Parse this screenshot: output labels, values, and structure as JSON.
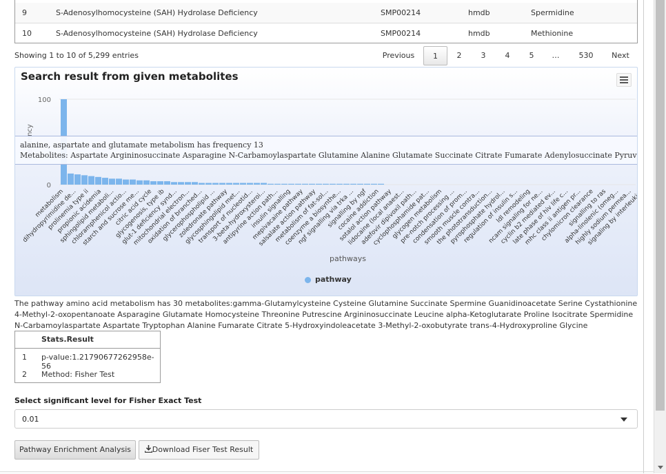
{
  "table": {
    "rows": [
      {
        "idx": "9",
        "name": "S-Adenosylhomocysteine (SAH) Hydrolase Deficiency",
        "smp": "SMP00214",
        "db": "hmdb",
        "metabolite": "Spermidine"
      },
      {
        "idx": "10",
        "name": "S-Adenosylhomocysteine (SAH) Hydrolase Deficiency",
        "smp": "SMP00214",
        "db": "hmdb",
        "metabolite": "Methionine"
      }
    ]
  },
  "pagination": {
    "info": "Showing 1 to 10 of 5,299 entries",
    "previous": "Previous",
    "pages": [
      "1",
      "2",
      "3",
      "4",
      "5",
      "…",
      "530"
    ],
    "next": "Next"
  },
  "chart_data": {
    "type": "bar",
    "title": "Search result from given metabolites",
    "ylabel": "Frequency",
    "xlabel": "pathways",
    "ylim": [
      0,
      100
    ],
    "yticks": [
      "100",
      "0"
    ],
    "categories": [
      "metabolism",
      "dihydropyrimidine de...",
      "prolinemia type ii",
      "propionic acidemia",
      "sphingolipid metaboli...",
      "chloramphenicol actio...",
      "starch and sucrose me...",
      "citric acid cycle",
      "glycogenosis, type ib",
      "glut-1 deficiency synd...",
      "mitochondrial electron...",
      "oxidation of branched...",
      "glycerophospholipid ...",
      "zoledronate pathway",
      "glycosphingolipid met...",
      "transport of nucleotid...",
      "3-beta-hydroxysteroi...",
      "antipyrine action path...",
      "insulin signalling",
      "mepivacaine pathway",
      "salsalate action pathway",
      "metabolism of fat-sol...",
      "coenzyme a biosynthe...",
      "ngf signalling via trka ...",
      "signalling by ngf",
      "cocaine addiction",
      "sotalol action pathway",
      "lidocaine (local anaest...",
      "adefovir dipivoxil path...",
      "cyclophosphamide pat...",
      "glycogen metabolism",
      "pre-notch processing ...",
      "condensation of prom...",
      "smooth muscle contra...",
      "the phototransduction...",
      "pyrophosphate hydrol...",
      "regulation of insulin s...",
      "ldl remodeling",
      "ncam signaling for ne...",
      "cyclin b2 mediated ev...",
      "late phase of hiv life c...",
      "mhc class ii antigen pr...",
      "chylomicron clearance",
      "signalling to ras",
      "alpha-linolenic (omeg...",
      "highly sodium permea...",
      "signaling by interleukins"
    ],
    "values": [
      100,
      13,
      12,
      11,
      10,
      9,
      8,
      7,
      7,
      6,
      6,
      5,
      5,
      4,
      4,
      4,
      3,
      3,
      3,
      3,
      2,
      2,
      2,
      2,
      2,
      2,
      2,
      2,
      2,
      2,
      1,
      1,
      1,
      1,
      1,
      1,
      1,
      1,
      1,
      1,
      1,
      1,
      1,
      1,
      1,
      1,
      1
    ],
    "legend": [
      "pathway"
    ],
    "legend_position": "bottom",
    "series_color": "#7cb5ec",
    "tooltip": {
      "line1": "alanine, aspartate and glutamate metabolism has frequency 13",
      "line2": "Metabolites: Aspartate Argininosuccinate Asparagine N-Carbamoylaspartate Glutamine Alanine Glutamate Succinate Citrate Fumarate Adenylosuccinate Pyruvate Glucosami"
    }
  },
  "description": "The pathway amino acid metabolism has 30 metabolites:gamma-Glutamylcysteine Cysteine Glutamine Succinate Spermine Guanidinoacetate Serine Cystathionine 4-Methyl-2-oxopentanoate Asparagine Glutamate Homocysteine Threonine Putrescine Argininosuccinate Leucine alpha-Ketoglutarate Proline Isocitrate Spermidine N-Carbamoylaspartate Aspartate Tryptophan Alanine Fumarate Citrate 5-Hydroxyindoleacetate 3-Methyl-2-oxobutyrate trans-4-Hydroxyproline Glycine",
  "stats": {
    "header": "Stats.Result",
    "rows": [
      {
        "idx": "1",
        "value": "p-value:1.21790677262958e-56"
      },
      {
        "idx": "2",
        "value": "Method: Fisher Test"
      }
    ]
  },
  "significance": {
    "label": "Select significant level for Fisher Exact Test",
    "value": "0.01"
  },
  "buttons": {
    "enrichment": "Pathway Enrichment Analysis",
    "download": "Download Fiser Test Result",
    "download_icon": "download-icon"
  }
}
